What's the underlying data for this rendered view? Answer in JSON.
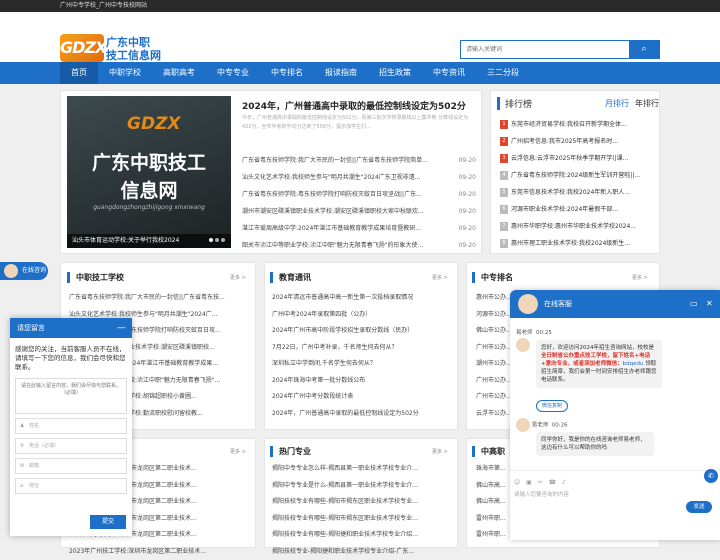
{
  "topbar": {
    "text": "广州中专学校_广州中专技校网站"
  },
  "header": {
    "logo_mark": "GDZX",
    "logo_line1": "广东中职",
    "logo_line2": "技工信息网",
    "search_placeholder": "请输入关键词",
    "search_icon": "search-icon"
  },
  "nav": [
    "首页",
    "中职学校",
    "高职高考",
    "中专专业",
    "中专排名",
    "报读指南",
    "招生政策",
    "中专资讯",
    "三二分段"
  ],
  "slider": {
    "brand": "GDZX",
    "line1": "广东中职技工",
    "line2": "信息网",
    "pinyin": "guangdongzhongzhijigong xinxiwang",
    "caption": "汕头市体育运动学校:关于举行我校2024"
  },
  "headline": {
    "title": "2024年，广州普通高中录取的最低控制线设定为502分",
    "summary": "今年，广州普通高中录取的最低控制线设定为502分，而第三批次学校录取线以上集中到 分数线设定为422分，全市中考的平均分达到了558分，提示加学生们..."
  },
  "news": [
    {
      "t": "广东省粤东技师学院:我厂大市民的一封信||广东省粤东技师学院简单...",
      "d": "09-20"
    },
    {
      "t": "汕头文化艺术学校:我校师生参与\"明月共潮生\"2024广东卫视非遗...",
      "d": "09-20"
    },
    {
      "t": "广东省粤东技师学院:粤东技师学院打响防校灭蚊百日攻坚战||广东...",
      "d": "09-20"
    },
    {
      "t": "潮州市潮安区磷溪镇职业技术学校:潮安区磷溪镇职校大家中秋联欢...",
      "d": "09-20"
    },
    {
      "t": "湛江市爱周高级中学:2024年湛江市基础教育教学成果培育暨教研...",
      "d": "09-20"
    },
    {
      "t": "韶关市浈江中等职业学校:浈江中职\"魅力无限青春飞扬\"的形象大使...",
      "d": "09-20"
    }
  ],
  "rank": {
    "title": "排行榜",
    "tabs": [
      "月排行",
      "年排行"
    ],
    "items": [
      "东莞市经济贸易学校:我校召开新学期全体...",
      "广州招考信息:我市2025年高考报名时...",
      "云浮信息:云浮市2025年秋季学期开学(|课...",
      "广东省粤东技师学院:2024级新生军训开营啦||...",
      "东莞市信息技术学校:我校2024年新入职人...",
      "河源市职业技术学校:2024年暑假干部...",
      "惠州市华职学校:惠州市华职业技术学校2024...",
      "惠州市理工职业技术学校:我校2024级新生..."
    ]
  },
  "sections": {
    "s1": {
      "title": "中职技工学校",
      "more": "更多 >",
      "items": [
        "广东省粤东技师学院:我厂大市民的一封信||广东省粤东技...",
        "汕头文化艺术学校:我校师生参与\"明月共潮生\"2024广...",
        "广东省粤东技师学院:粤东技师学院打响防校灭蚊百日攻...",
        "潮州市潮安区磷溪镇职业技术学校:潮安区磷溪镇职校...",
        "湛江市爱周高级中学:2024年湛江市基础教育教学成果...",
        "韶关市浈江中等职业学校:浈江中职\"魅力无限青春飞扬\"...",
        "广州市越秀区职业技术学校:胡锦超职校小黄圃...",
        "广州市越秀区职业技术学校:勤流职校慰问留校教..."
      ]
    },
    "s2": {
      "title": "教育通讯",
      "more": "更多 >",
      "items": [
        "2024年清远市普通高中高一新生第一次投档录取情况",
        "广州中考2024年录取第四批（公办）",
        "2024年广州市高中阶段学校招生录取分数线（民办）",
        "7月22日，广州中考补录，千名师生何去何从？",
        "深圳私立中学倒闭,千名学生何去何从？",
        "2024年珠海中考第一批分数线公布",
        "2024年广州中考分数段统计表",
        "2024年，广州普通高中录取的最低控制线设定为502分"
      ]
    },
    "s3": {
      "title": "中专排名",
      "more": "更多 >",
      "items": [
        "惠州市公办...",
        "河源市公办...",
        "佛山市公办...",
        "广州市公办...",
        "潮州市公办...",
        "广州市公办...",
        "广州市公办...",
        "云浮市公办..."
      ]
    },
    "s4": {
      "title": "",
      "more": "更多 >",
      "items": [
        "广州中专学校简章:深圳市龙岗区第二职业技术...",
        "广州中专学校简章:深圳市龙岗区第二职业技术...",
        "广州中专学校简章:深圳市龙岗区第二职业技术...",
        "广州中专学校简章:深圳市龙岗区第二职业技术...",
        "广州中专学校简章:深圳市龙岗区第二职业技术...",
        "2023年广州技工学校:深圳市龙岗区第二职业技术..."
      ]
    },
    "s5": {
      "title": "热门专业",
      "more": "更多 >",
      "items": [
        "揭阳中专专业怎么样-揭西县第一职业技术学校专业介...",
        "揭阳中专专业是什么-揭西县第一职业技术学校专业介...",
        "揭阳技校专业有哪些-揭阳市揭东区职业技术学校专业...",
        "揭阳技校专业有哪些-揭阳市揭东区职业技术学校专业...",
        "揭阳技校专业有哪些-揭阳捷和职业技术学校专业介绍...",
        "揭阳技校专业-揭阳捷和职业技术学校专业介绍-广东..."
      ]
    },
    "s6": {
      "title": "中高职",
      "more": "",
      "items": [
        "珠海市第...",
        "佛山市高...",
        "佛山市高...",
        "雷州市职...",
        "雷州市职..."
      ]
    }
  },
  "float_btn": {
    "label": "在线咨询"
  },
  "message": {
    "title": "请您留言",
    "intro": "感谢您的关注，当前客服人员不在线，请填写一下您的信息，我们会尽快和您联系。",
    "placeholder": "请在此输入留言内容，我们会尽快与您联系。（必填）",
    "fields": [
      "姓名",
      "电话（必填）",
      "邮箱",
      "地址"
    ],
    "submit": "提交"
  },
  "chat": {
    "title": "在线客服",
    "agent": "易老师",
    "time1": "00:25",
    "time2": "00:26",
    "m1a": "您好，欢迎访问2024年招生咨询网站，校校是",
    "m1b": "全日制省公办重点技工学校，留下姓名+电话+意向专业，或者添加老师微信：",
    "m1c": "bdqedu",
    "m1d": " 领取招生简章，我们会第一时间安排招生办老师跟您电话联系。",
    "link": "微信复制",
    "m2": "同学你好，我是你的在线咨询老师易老师，这边有什么可以帮助你的吗",
    "placeholder": "请输入您要咨询的内容",
    "send": "发送",
    "tools": "☺ ▣ ✂ ☎ ♪"
  }
}
